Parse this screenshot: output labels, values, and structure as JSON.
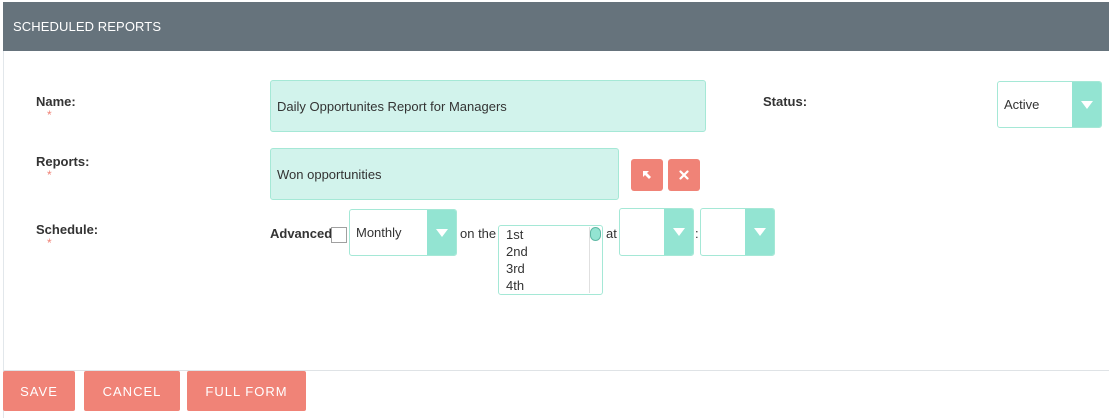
{
  "panel": {
    "title": "SCHEDULED REPORTS"
  },
  "form": {
    "name": {
      "label": "Name:",
      "required_mark": "*",
      "value": "Daily Opportunites Report for Managers"
    },
    "status": {
      "label": "Status:",
      "selected": "Active"
    },
    "reports": {
      "label": "Reports:",
      "required_mark": "*",
      "value": "Won opportunities",
      "select_icon": "arrow-select-icon",
      "clear_icon": "close-x-icon"
    },
    "schedule": {
      "label": "Schedule:",
      "required_mark": "*",
      "advanced_label": "Advanced",
      "advanced_checked": false,
      "frequency": "Monthly",
      "on_the_label": "on the",
      "days": [
        "1st",
        "2nd",
        "3rd",
        "4th"
      ],
      "at_label": "at",
      "hour": "",
      "separator": ":",
      "minute": ""
    }
  },
  "footer": {
    "save_label": "SAVE",
    "cancel_label": "CANCEL",
    "full_form_label": "FULL FORM"
  },
  "colors": {
    "header_bg": "#66737c",
    "input_bg": "#d2f3ec",
    "accent": "#93e4d2",
    "button": "#f08377",
    "required": "#f08377"
  }
}
